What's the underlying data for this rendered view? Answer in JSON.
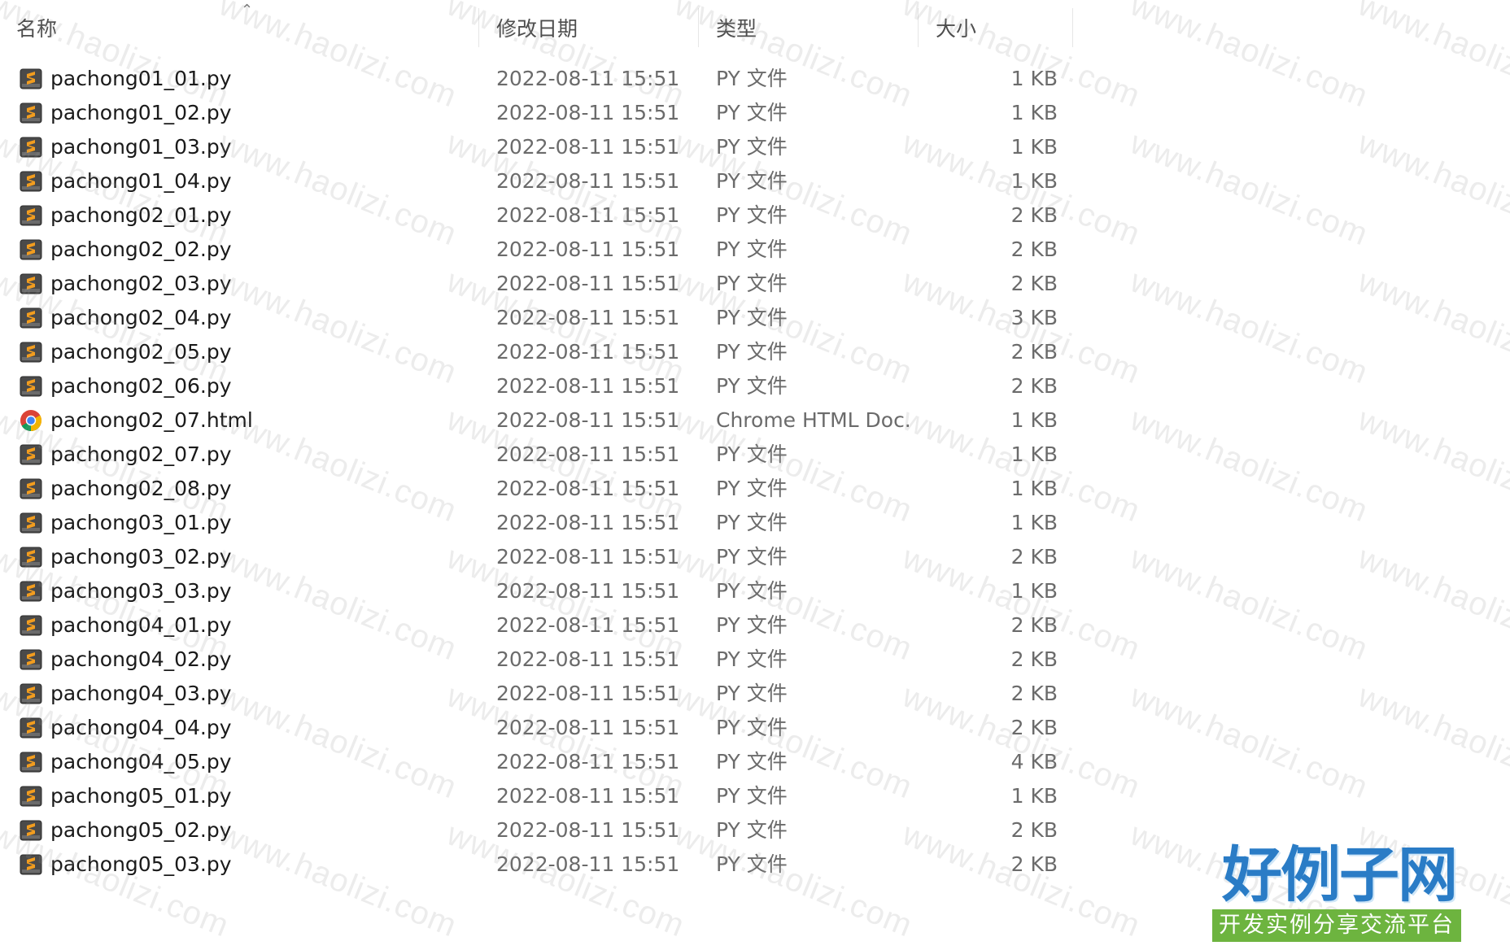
{
  "columns": {
    "name": "名称",
    "modified": "修改日期",
    "type": "类型",
    "size": "大小"
  },
  "sort_icon": "chevron-up-icon",
  "files": [
    {
      "name": "pachong01_01.py",
      "modified": "2022-08-11 15:51",
      "type": "PY 文件",
      "size": "1 KB",
      "icon": "sublime-text-icon"
    },
    {
      "name": "pachong01_02.py",
      "modified": "2022-08-11 15:51",
      "type": "PY 文件",
      "size": "1 KB",
      "icon": "sublime-text-icon"
    },
    {
      "name": "pachong01_03.py",
      "modified": "2022-08-11 15:51",
      "type": "PY 文件",
      "size": "1 KB",
      "icon": "sublime-text-icon"
    },
    {
      "name": "pachong01_04.py",
      "modified": "2022-08-11 15:51",
      "type": "PY 文件",
      "size": "1 KB",
      "icon": "sublime-text-icon"
    },
    {
      "name": "pachong02_01.py",
      "modified": "2022-08-11 15:51",
      "type": "PY 文件",
      "size": "2 KB",
      "icon": "sublime-text-icon"
    },
    {
      "name": "pachong02_02.py",
      "modified": "2022-08-11 15:51",
      "type": "PY 文件",
      "size": "2 KB",
      "icon": "sublime-text-icon"
    },
    {
      "name": "pachong02_03.py",
      "modified": "2022-08-11 15:51",
      "type": "PY 文件",
      "size": "2 KB",
      "icon": "sublime-text-icon"
    },
    {
      "name": "pachong02_04.py",
      "modified": "2022-08-11 15:51",
      "type": "PY 文件",
      "size": "3 KB",
      "icon": "sublime-text-icon"
    },
    {
      "name": "pachong02_05.py",
      "modified": "2022-08-11 15:51",
      "type": "PY 文件",
      "size": "2 KB",
      "icon": "sublime-text-icon"
    },
    {
      "name": "pachong02_06.py",
      "modified": "2022-08-11 15:51",
      "type": "PY 文件",
      "size": "2 KB",
      "icon": "sublime-text-icon"
    },
    {
      "name": "pachong02_07.html",
      "modified": "2022-08-11 15:51",
      "type": "Chrome HTML Doc...",
      "size": "1 KB",
      "icon": "chrome-icon"
    },
    {
      "name": "pachong02_07.py",
      "modified": "2022-08-11 15:51",
      "type": "PY 文件",
      "size": "1 KB",
      "icon": "sublime-text-icon"
    },
    {
      "name": "pachong02_08.py",
      "modified": "2022-08-11 15:51",
      "type": "PY 文件",
      "size": "1 KB",
      "icon": "sublime-text-icon"
    },
    {
      "name": "pachong03_01.py",
      "modified": "2022-08-11 15:51",
      "type": "PY 文件",
      "size": "1 KB",
      "icon": "sublime-text-icon"
    },
    {
      "name": "pachong03_02.py",
      "modified": "2022-08-11 15:51",
      "type": "PY 文件",
      "size": "2 KB",
      "icon": "sublime-text-icon"
    },
    {
      "name": "pachong03_03.py",
      "modified": "2022-08-11 15:51",
      "type": "PY 文件",
      "size": "1 KB",
      "icon": "sublime-text-icon"
    },
    {
      "name": "pachong04_01.py",
      "modified": "2022-08-11 15:51",
      "type": "PY 文件",
      "size": "2 KB",
      "icon": "sublime-text-icon"
    },
    {
      "name": "pachong04_02.py",
      "modified": "2022-08-11 15:51",
      "type": "PY 文件",
      "size": "2 KB",
      "icon": "sublime-text-icon"
    },
    {
      "name": "pachong04_03.py",
      "modified": "2022-08-11 15:51",
      "type": "PY 文件",
      "size": "2 KB",
      "icon": "sublime-text-icon"
    },
    {
      "name": "pachong04_04.py",
      "modified": "2022-08-11 15:51",
      "type": "PY 文件",
      "size": "2 KB",
      "icon": "sublime-text-icon"
    },
    {
      "name": "pachong04_05.py",
      "modified": "2022-08-11 15:51",
      "type": "PY 文件",
      "size": "4 KB",
      "icon": "sublime-text-icon"
    },
    {
      "name": "pachong05_01.py",
      "modified": "2022-08-11 15:51",
      "type": "PY 文件",
      "size": "1 KB",
      "icon": "sublime-text-icon"
    },
    {
      "name": "pachong05_02.py",
      "modified": "2022-08-11 15:51",
      "type": "PY 文件",
      "size": "2 KB",
      "icon": "sublime-text-icon"
    },
    {
      "name": "pachong05_03.py",
      "modified": "2022-08-11 15:51",
      "type": "PY 文件",
      "size": "2 KB",
      "icon": "sublime-text-icon"
    }
  ],
  "watermark": {
    "text": "www.haolizi.com"
  },
  "logo": {
    "title": "好例子网",
    "subtitle": "开发实例分享交流平台",
    "title_color": "#2a7cc6",
    "bar_color": "#6db43f"
  }
}
